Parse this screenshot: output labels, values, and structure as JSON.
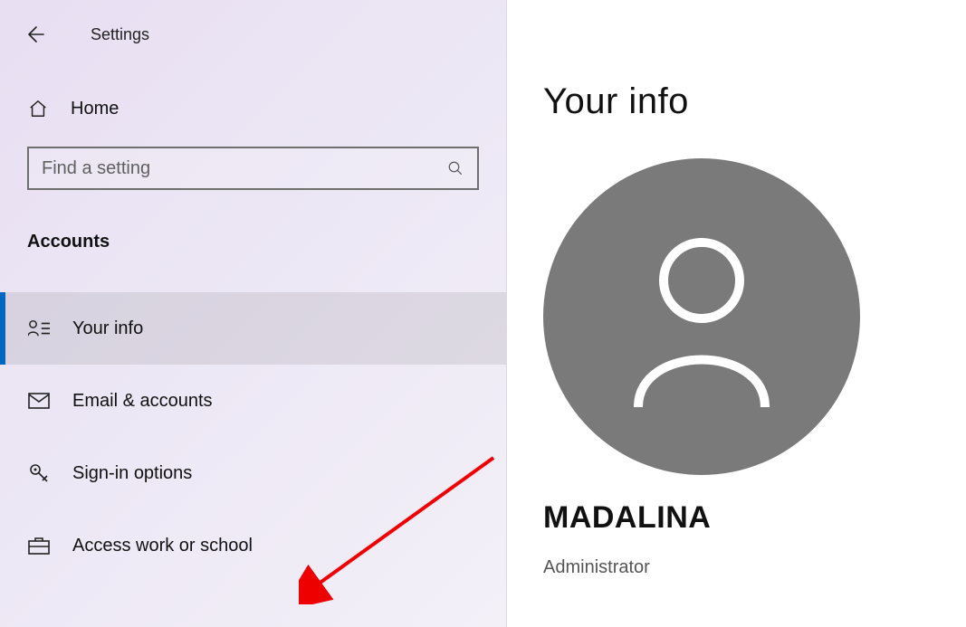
{
  "app_title": "Settings",
  "home_label": "Home",
  "search": {
    "placeholder": "Find a setting"
  },
  "section_header": "Accounts",
  "nav": [
    {
      "label": "Your info",
      "selected": true
    },
    {
      "label": "Email & accounts"
    },
    {
      "label": "Sign-in options"
    },
    {
      "label": "Access work or school"
    }
  ],
  "page": {
    "title": "Your info",
    "user_name": "MADALINA",
    "user_role": "Administrator"
  },
  "colors": {
    "accent": "#0067c0",
    "avatar_bg": "#7a7a7a",
    "annotation": "#ef0000"
  }
}
